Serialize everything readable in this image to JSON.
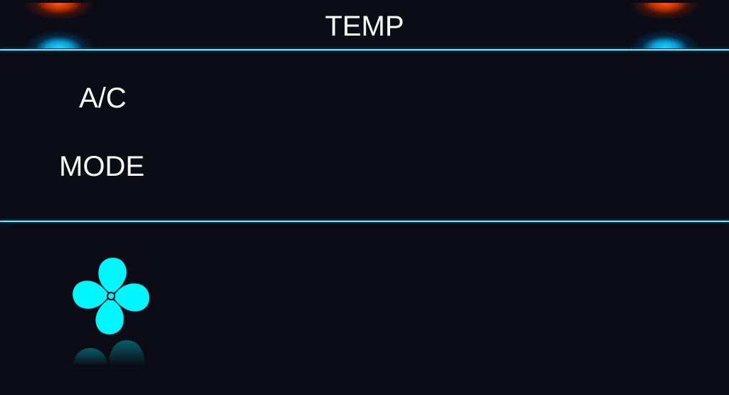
{
  "header": {
    "title": "TEMP"
  },
  "temp_controls": {
    "left": {
      "up_icon": "temperature-up-glow-icon",
      "down_icon": "temperature-down-glow-icon"
    },
    "right": {
      "up_icon": "temperature-up-glow-icon",
      "down_icon": "temperature-down-glow-icon"
    }
  },
  "controls": {
    "ac_label": "A/C",
    "mode_label": "MODE"
  },
  "fan": {
    "icon": "fan-icon"
  },
  "colors": {
    "background": "#0b0c16",
    "divider": "#7fe6ff",
    "fan": "#00f6ff",
    "warm_glow": "#ff5a1a",
    "cool_glow": "#22d8ff",
    "text": "#ffffff"
  }
}
